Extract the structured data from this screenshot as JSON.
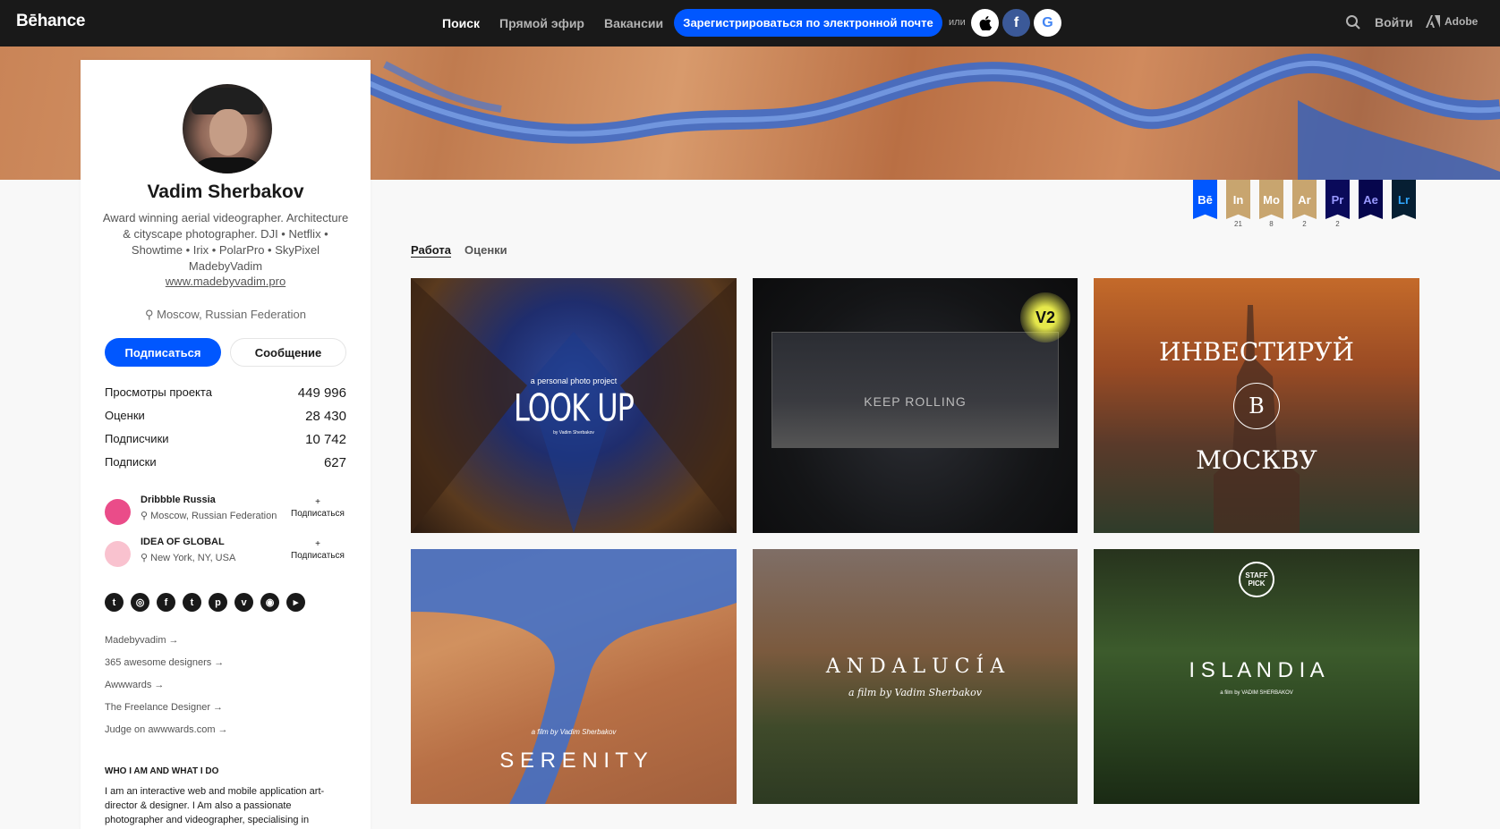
{
  "header": {
    "logo": "Bēhance",
    "nav": [
      "Поиск",
      "Прямой эфир",
      "Вакансии"
    ],
    "signup": "Зарегистрироваться по электронной почте",
    "or": "или",
    "social_login": [
      "",
      "f",
      "G"
    ],
    "login": "Войти",
    "adobe": "Adobe"
  },
  "profile": {
    "name": "Vadim Sherbakov",
    "bio": "Award winning aerial videographer. Architecture & cityscape photographer. DJI • Netflix • Showtime • Irix • PolarPro • SkyPixel MadebyVadim",
    "site": "www.madebyvadim.pro",
    "location": "Moscow, Russian Federation",
    "follow": "Подписаться",
    "message": "Сообщение",
    "stats": [
      {
        "label": "Просмотры проекта",
        "value": "449 996"
      },
      {
        "label": "Оценки",
        "value": "28 430"
      },
      {
        "label": "Подписчики",
        "value": "10 742"
      },
      {
        "label": "Подписки",
        "value": "627"
      }
    ],
    "teams": [
      {
        "name": "Dribbble Russia",
        "location": "Moscow, Russian Federation",
        "follow_plus": "+",
        "follow": "Подписаться",
        "color": "#ea4c89"
      },
      {
        "name": "IDEA OF GLOBAL",
        "location": "New York, NY, USA",
        "follow_plus": "+",
        "follow": "Подписаться",
        "color": "#f9c2cf"
      }
    ],
    "socials": [
      "twitter-icon",
      "dribbble-icon",
      "facebook-icon",
      "tumblr-icon",
      "pinterest-icon",
      "vimeo-icon",
      "instagram-icon",
      "youtube-icon"
    ],
    "links": [
      "Madebyvadim →",
      "365 awesome designers →",
      "Awwwards →",
      "The Freelance Designer →",
      "Judge on awwwards.com →"
    ],
    "about_heading": "WHO I AM AND WHAT I DO",
    "about_text": "I am an interactive web and mobile application art-director & designer. I Am also a passionate photographer and videographer, specialising in"
  },
  "badges": [
    {
      "label": "Bē",
      "count": "",
      "color": "#0057ff"
    },
    {
      "label": "In",
      "count": "21",
      "color": "#c8a56f"
    },
    {
      "label": "Mo",
      "count": "8",
      "color": "#c8a56f"
    },
    {
      "label": "Ar",
      "count": "2",
      "color": "#c8a56f"
    },
    {
      "label": "Pr",
      "count": "2",
      "color": "#0a0a5a"
    },
    {
      "label": "Ae",
      "count": "",
      "color": "#06064d"
    },
    {
      "label": "Lr",
      "count": "",
      "color": "#061f33"
    }
  ],
  "tabs": [
    "Работа",
    "Оценки"
  ],
  "projects": [
    {
      "lines": [
        "a personal photo project",
        "LOOK UP",
        "by Vadim Sherbakov"
      ]
    },
    {
      "lines": [
        "KEEP ROLLING",
        "V2"
      ]
    },
    {
      "lines": [
        "ИНВЕСТИРУЙ",
        "B",
        "МОСКВУ"
      ]
    },
    {
      "lines": [
        "a film by Vadim Sherbakov",
        "S E R E N I T Y"
      ]
    },
    {
      "lines": [
        "A N D A L U C Í A",
        "a film by Vadim Sherbakov"
      ]
    },
    {
      "lines": [
        "STAFF PICK",
        "I S L A N D I A",
        "a film by VADIM SHERBAKOV"
      ]
    }
  ]
}
